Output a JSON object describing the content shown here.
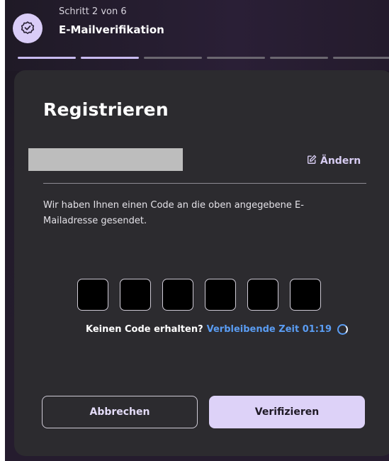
{
  "header": {
    "step_count": "Schritt 2 von 6",
    "step_title": "E-Mailverifikation",
    "badge_icon": "check-badge-icon",
    "progress": {
      "total": 6,
      "completed": 2
    }
  },
  "card": {
    "title": "Registrieren",
    "change_label": "Ändern",
    "change_icon": "edit-icon",
    "info_text": "Wir haben Ihnen einen Code an die oben angegebene E-Mailadresse gesendet.",
    "code_fields": 6,
    "resend_question": "Keinen Code erhalten?",
    "remaining_time": "Verbleibende Zeit 01:19",
    "cancel_label": "Abbrechen",
    "verify_label": "Verifizieren"
  },
  "colors": {
    "accent": "#ddd2f8",
    "link": "#5a9cf2",
    "card_bg": "#2c2b2f"
  }
}
